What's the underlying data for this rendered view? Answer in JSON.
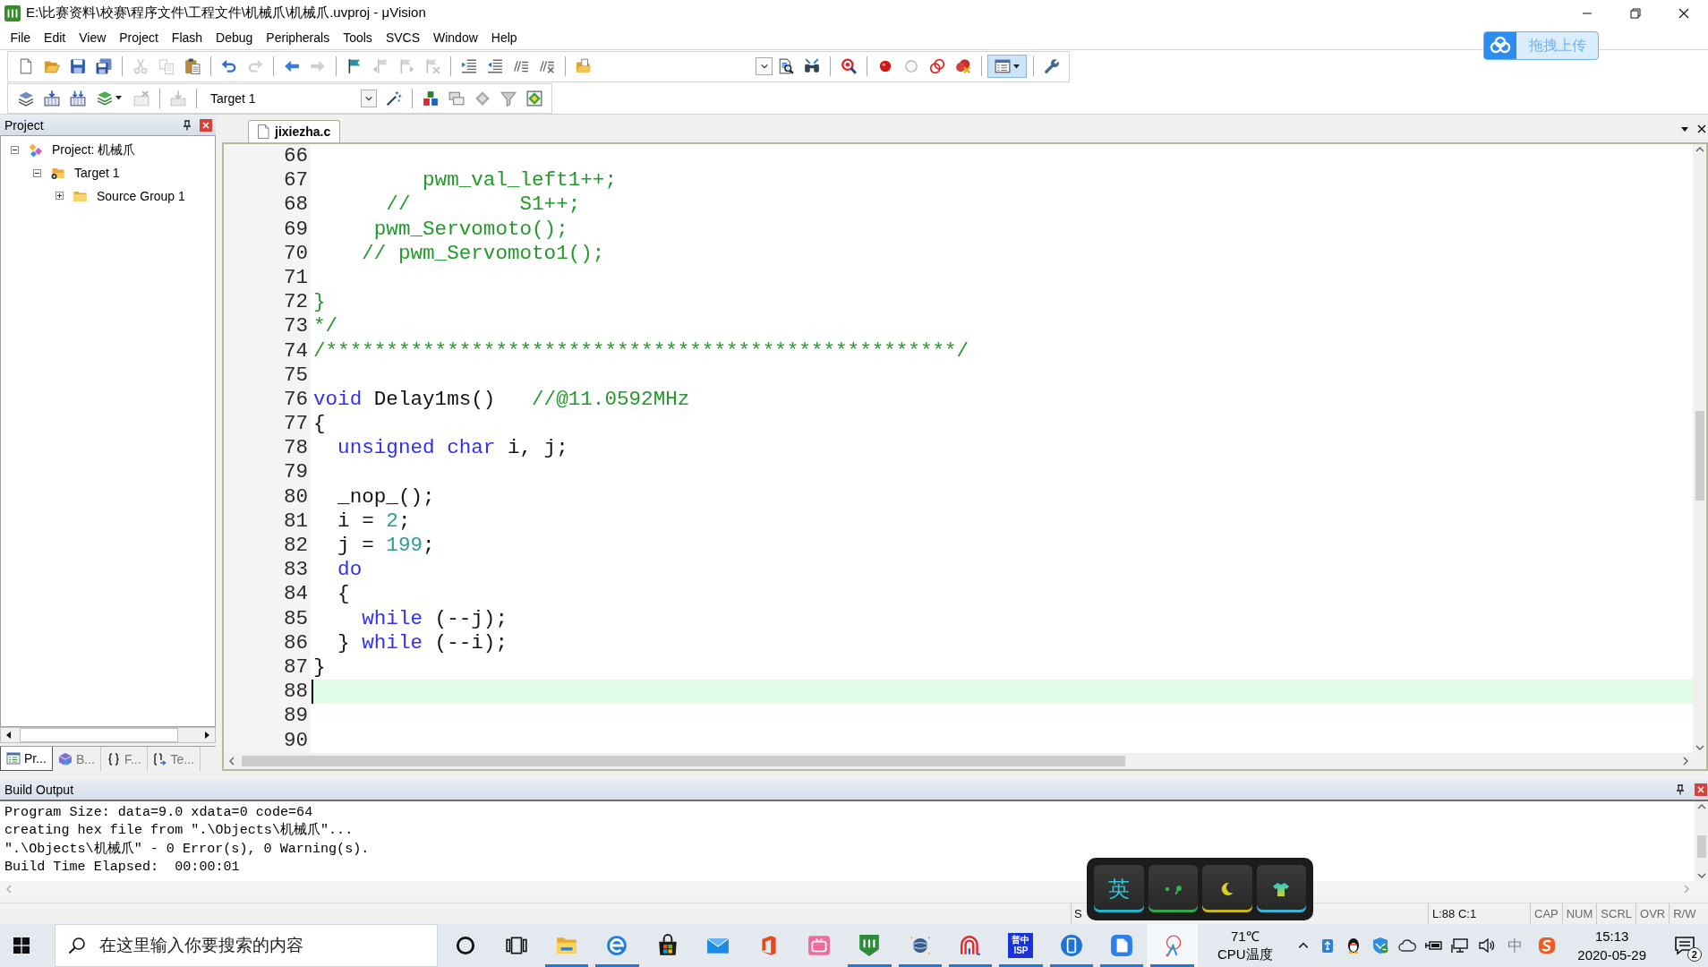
{
  "window": {
    "title": "E:\\比赛资料\\校赛\\程序文件\\工程文件\\机械爪\\机械爪.uvproj - μVision"
  },
  "menu": [
    "File",
    "Edit",
    "View",
    "Project",
    "Flash",
    "Debug",
    "Peripherals",
    "Tools",
    "SVCS",
    "Window",
    "Help"
  ],
  "upload_button": {
    "label": "拖拽上传"
  },
  "toolbar_1": [
    {
      "kind": "new",
      "disabled": false,
      "pressed": false
    },
    {
      "kind": "open",
      "disabled": false,
      "pressed": false
    },
    {
      "kind": "save",
      "disabled": false,
      "pressed": false
    },
    {
      "kind": "save_all",
      "disabled": false,
      "pressed": false
    },
    {
      "kind": "separator"
    },
    {
      "kind": "cut",
      "disabled": true,
      "pressed": false
    },
    {
      "kind": "copy",
      "disabled": true,
      "pressed": false
    },
    {
      "kind": "paste",
      "disabled": false,
      "pressed": false
    },
    {
      "kind": "separator"
    },
    {
      "kind": "undo",
      "disabled": false,
      "pressed": false
    },
    {
      "kind": "redo",
      "disabled": true,
      "pressed": false
    },
    {
      "kind": "separator"
    },
    {
      "kind": "back",
      "disabled": false,
      "pressed": false
    },
    {
      "kind": "forward",
      "disabled": true,
      "pressed": false
    },
    {
      "kind": "separator"
    },
    {
      "kind": "bookmark",
      "disabled": false,
      "pressed": false
    },
    {
      "kind": "bookmark_prev",
      "disabled": true,
      "pressed": false
    },
    {
      "kind": "bookmark_next",
      "disabled": true,
      "pressed": false
    },
    {
      "kind": "bookmark_clear",
      "disabled": true,
      "pressed": false
    },
    {
      "kind": "separator"
    },
    {
      "kind": "indent",
      "disabled": false,
      "pressed": false
    },
    {
      "kind": "unindent",
      "disabled": false,
      "pressed": false
    },
    {
      "kind": "comment",
      "disabled": false,
      "pressed": false
    },
    {
      "kind": "uncomment",
      "disabled": false,
      "pressed": false
    },
    {
      "kind": "separator"
    },
    {
      "kind": "find_in_files",
      "disabled": false,
      "pressed": false
    },
    {
      "kind": "combo"
    },
    {
      "kind": "find",
      "disabled": false,
      "pressed": false
    },
    {
      "kind": "binoculars",
      "disabled": false,
      "pressed": false
    },
    {
      "kind": "separator"
    },
    {
      "kind": "debug",
      "disabled": false,
      "pressed": false
    },
    {
      "kind": "separator"
    },
    {
      "kind": "breakpoint",
      "disabled": false,
      "pressed": false
    },
    {
      "kind": "ring",
      "disabled": false,
      "pressed": false
    },
    {
      "kind": "rings",
      "disabled": false,
      "pressed": false
    },
    {
      "kind": "breakpoint_remove",
      "disabled": false,
      "pressed": false
    },
    {
      "kind": "separator"
    },
    {
      "kind": "layout",
      "disabled": false,
      "pressed": true
    },
    {
      "kind": "separator"
    },
    {
      "kind": "wrench",
      "disabled": false,
      "pressed": false
    }
  ],
  "toolbar_2": [
    {
      "kind": "layers",
      "disabled": false
    },
    {
      "kind": "build",
      "disabled": false
    },
    {
      "kind": "rebuild",
      "disabled": false
    },
    {
      "kind": "batch",
      "disabled": false
    },
    {
      "kind": "stop",
      "disabled": true
    },
    {
      "kind": "separator"
    },
    {
      "kind": "download",
      "disabled": true
    },
    {
      "kind": "separator"
    },
    {
      "kind": "target_select",
      "value": "Target 1"
    },
    {
      "kind": "wand",
      "disabled": false
    },
    {
      "kind": "separator"
    },
    {
      "kind": "blocks",
      "disabled": false
    },
    {
      "kind": "windows",
      "disabled": false
    },
    {
      "kind": "diamond",
      "disabled": false
    },
    {
      "kind": "funnel",
      "disabled": false
    },
    {
      "kind": "package",
      "disabled": false
    }
  ],
  "project_panel": {
    "title": "Project",
    "tree": [
      {
        "kind": "project",
        "label": "Project: 机械爪",
        "expanded": true,
        "children": [
          {
            "kind": "target",
            "label": "Target 1",
            "expanded": true,
            "children": [
              {
                "kind": "group",
                "label": "Source Group 1",
                "expanded": false
              }
            ]
          }
        ]
      }
    ],
    "tabs": [
      {
        "kind": "project",
        "label": "Pr...",
        "selected": true
      },
      {
        "kind": "books",
        "label": "B...",
        "selected": false
      },
      {
        "kind": "functions",
        "label": "F...",
        "selected": false
      },
      {
        "kind": "templates",
        "label": "Te...",
        "selected": false
      }
    ]
  },
  "editor": {
    "tabs": [
      {
        "label": "jixiezha.c",
        "selected": true
      }
    ],
    "lines": [
      {
        "number": "66",
        "current": false
      },
      {
        "number": "67",
        "current": false,
        "tokens": [
          {
            "kind": "comment",
            "text": "         pwm_val_left1++;"
          }
        ]
      },
      {
        "number": "68",
        "current": false,
        "tokens": [
          {
            "kind": "comment",
            "text": "      //         S1++;"
          }
        ]
      },
      {
        "number": "69",
        "current": false,
        "tokens": [
          {
            "kind": "comment",
            "text": "     pwm_Servomoto();"
          }
        ]
      },
      {
        "number": "70",
        "current": false,
        "tokens": [
          {
            "kind": "comment",
            "text": "    // pwm_Servomoto1();"
          }
        ]
      },
      {
        "number": "71",
        "current": false
      },
      {
        "number": "72",
        "current": false,
        "tokens": [
          {
            "kind": "comment",
            "text": "}"
          }
        ]
      },
      {
        "number": "73",
        "current": false,
        "tokens": [
          {
            "kind": "comment",
            "text": "*/"
          }
        ]
      },
      {
        "number": "74",
        "current": false,
        "tokens": [
          {
            "kind": "comment",
            "text": "/****************************************************/"
          }
        ]
      },
      {
        "number": "75",
        "current": false
      },
      {
        "number": "76",
        "current": false,
        "tokens": [
          {
            "kind": "keyword",
            "text": "void"
          },
          {
            "kind": "plain",
            "text": " Delay1ms()   "
          },
          {
            "kind": "comment",
            "text": "//@11.0592MHz"
          }
        ]
      },
      {
        "number": "77",
        "current": false,
        "tokens": [
          {
            "kind": "plain",
            "text": "{"
          }
        ]
      },
      {
        "number": "78",
        "current": false,
        "tokens": [
          {
            "kind": "keyword",
            "text": "  unsigned char"
          },
          {
            "kind": "plain",
            "text": " i, j;"
          }
        ]
      },
      {
        "number": "79",
        "current": false
      },
      {
        "number": "80",
        "current": false,
        "tokens": [
          {
            "kind": "plain",
            "text": "  _nop_();"
          }
        ]
      },
      {
        "number": "81",
        "current": false,
        "tokens": [
          {
            "kind": "plain",
            "text": "  i = "
          },
          {
            "kind": "number",
            "text": "2"
          },
          {
            "kind": "plain",
            "text": ";"
          }
        ]
      },
      {
        "number": "82",
        "current": false,
        "tokens": [
          {
            "kind": "plain",
            "text": "  j = "
          },
          {
            "kind": "number",
            "text": "199"
          },
          {
            "kind": "plain",
            "text": ";"
          }
        ]
      },
      {
        "number": "83",
        "current": false,
        "tokens": [
          {
            "kind": "keyword",
            "text": "  do"
          }
        ]
      },
      {
        "number": "84",
        "current": false,
        "tokens": [
          {
            "kind": "plain",
            "text": "  {"
          }
        ]
      },
      {
        "number": "85",
        "current": false,
        "tokens": [
          {
            "kind": "keyword",
            "text": "    while"
          },
          {
            "kind": "plain",
            "text": " (--j);"
          }
        ]
      },
      {
        "number": "86",
        "current": false,
        "tokens": [
          {
            "kind": "plain",
            "text": "  } "
          },
          {
            "kind": "keyword",
            "text": "while"
          },
          {
            "kind": "plain",
            "text": " (--i);"
          }
        ]
      },
      {
        "number": "87",
        "current": false,
        "tokens": [
          {
            "kind": "plain",
            "text": "}"
          }
        ]
      },
      {
        "number": "88",
        "current": true
      },
      {
        "number": "89",
        "current": false
      },
      {
        "number": "90",
        "current": false
      }
    ]
  },
  "build_output": {
    "title": "Build Output",
    "lines": [
      "Program Size: data=9.0 xdata=0 code=64",
      "creating hex file from \".\\Objects\\机械爪\"...",
      "\".\\Objects\\机械爪\" - 0 Error(s), 0 Warning(s).",
      "Build Time Elapsed:  00:00:01"
    ]
  },
  "status_bar": {
    "message": "S",
    "cursor": "L:88 C:1",
    "indicators": [
      "CAP",
      "NUM",
      "SCRL",
      "OVR",
      "R/W"
    ]
  },
  "ime_toolbar": {
    "keys": [
      {
        "kind": "language",
        "label": "英"
      },
      {
        "kind": "punctuation"
      },
      {
        "kind": "night"
      },
      {
        "kind": "skin"
      }
    ]
  },
  "taskbar": {
    "search": {
      "placeholder": "在这里输入你要搜索的内容"
    },
    "apps": [
      {
        "kind": "ring",
        "running": false,
        "selected": false
      },
      {
        "kind": "taskview",
        "running": false,
        "selected": false
      },
      {
        "kind": "folder",
        "running": true,
        "selected": false
      },
      {
        "kind": "browser",
        "running": true,
        "selected": false
      },
      {
        "kind": "bag",
        "running": false,
        "selected": false
      },
      {
        "kind": "mail",
        "running": false,
        "selected": false
      },
      {
        "kind": "office",
        "running": false,
        "selected": false
      },
      {
        "kind": "tv",
        "running": false,
        "selected": false
      },
      {
        "kind": "shield_tile",
        "running": true,
        "selected": false
      },
      {
        "kind": "globe",
        "running": true,
        "selected": false
      },
      {
        "kind": "arches",
        "running": true,
        "selected": false
      },
      {
        "kind": "text_tile",
        "label": "普中",
        "sublabel": "ISP",
        "running": true,
        "selected": false
      },
      {
        "kind": "tablet",
        "running": true,
        "selected": false
      },
      {
        "kind": "doc_tile",
        "running": true,
        "selected": false
      },
      {
        "kind": "snip",
        "running": true,
        "selected": true
      }
    ],
    "cpu": {
      "temperature": "71℃",
      "label": "CPU温度"
    },
    "input_mode": "中",
    "clock": {
      "time": "15:13",
      "date": "2020-05-29"
    },
    "notifications": {
      "count": "2"
    }
  }
}
